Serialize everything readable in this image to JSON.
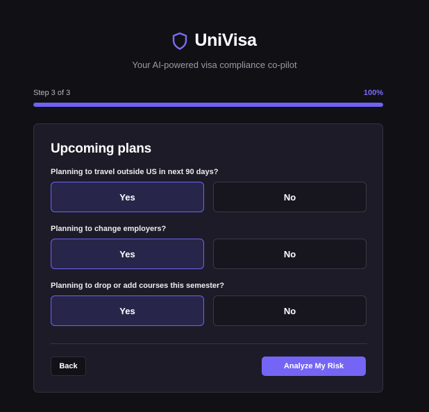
{
  "brand": {
    "name": "UniVisa",
    "tagline": "Your AI-powered visa compliance co-pilot",
    "icon": "shield-icon",
    "accent_color": "#6f62f5"
  },
  "progress": {
    "step_label": "Step 3 of 3",
    "percent_label": "100%",
    "value": 1.0
  },
  "form": {
    "title": "Upcoming plans",
    "questions": [
      {
        "label": "Planning to travel outside US in next 90 days?",
        "yes_label": "Yes",
        "no_label": "No",
        "selected": "Yes"
      },
      {
        "label": "Planning to change employers?",
        "yes_label": "Yes",
        "no_label": "No",
        "selected": "Yes"
      },
      {
        "label": "Planning to drop or add courses this semester?",
        "yes_label": "Yes",
        "no_label": "No",
        "selected": "Yes"
      }
    ],
    "back_label": "Back",
    "submit_label": "Analyze My Risk"
  }
}
